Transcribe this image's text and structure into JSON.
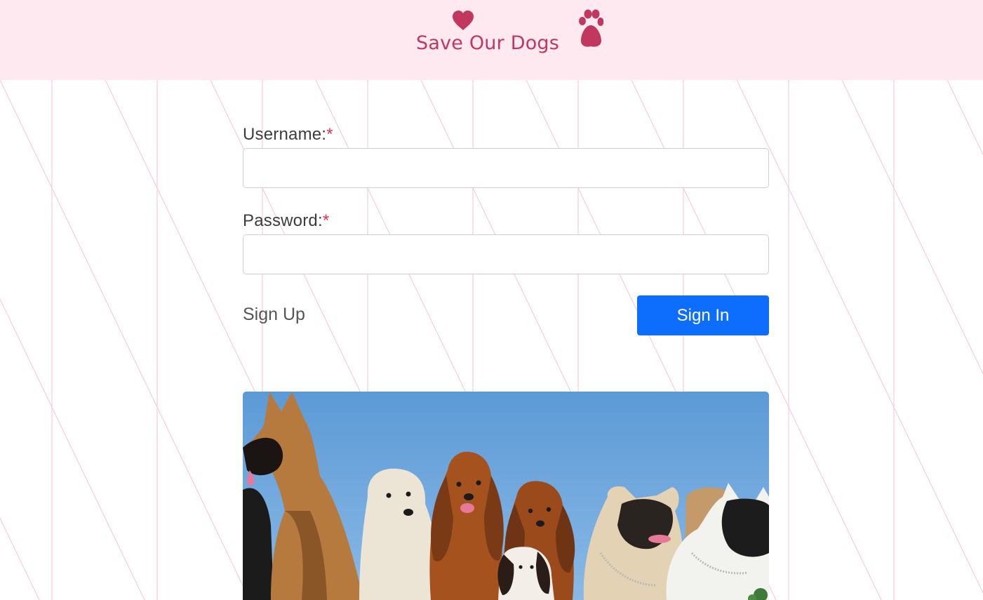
{
  "header": {
    "brand_name": "Save Our Dogs",
    "brand_color": "#c2375f",
    "background": "#fde9ef",
    "icons": [
      "heart-icon",
      "paw-icon"
    ]
  },
  "login_form": {
    "username_label": "Username:",
    "password_label": "Password:",
    "required_marker": "*",
    "username_value": "",
    "password_value": "",
    "signup_link": "Sign Up",
    "signin_button": "Sign In",
    "button_color": "#0d6efd"
  },
  "hero_image": {
    "alt": "Group of dogs",
    "content": [
      "german-shepherd",
      "west-highland-terrier",
      "cocker-spaniel",
      "cocker-spaniel",
      "cavalier-puppy",
      "pug",
      "french-bulldog"
    ]
  }
}
